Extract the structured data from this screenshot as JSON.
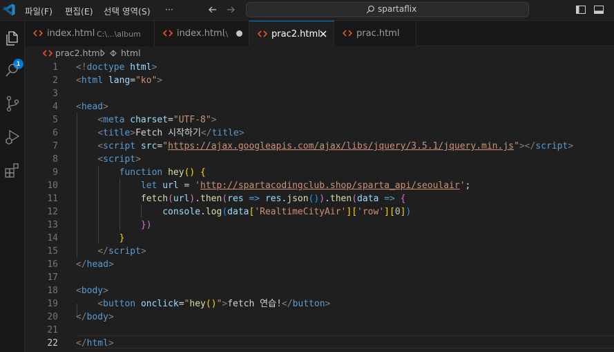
{
  "menu": {
    "file": "파일(F)",
    "edit": "편집(E)",
    "selection": "선택 영역(S)",
    "more": "···"
  },
  "command_center": {
    "text": "spartaflix"
  },
  "activity": {
    "explorer_badge": "1"
  },
  "tabs": [
    {
      "name": "index.html",
      "desc": "C:\\...\\album",
      "active": false,
      "dirty": false
    },
    {
      "name": "index.html",
      "desc": ".\\",
      "active": false,
      "dirty": true
    },
    {
      "name": "prac2.html",
      "desc": "",
      "active": true,
      "dirty": false
    },
    {
      "name": "prac.html",
      "desc": "",
      "active": false,
      "dirty": false
    }
  ],
  "breadcrumb": {
    "file": "prac2.html",
    "element": "html"
  },
  "editor": {
    "current_line": 22,
    "line_numbers": [
      "1",
      "2",
      "3",
      "4",
      "5",
      "6",
      "7",
      "8",
      "9",
      "10",
      "11",
      "12",
      "13",
      "14",
      "15",
      "16",
      "17",
      "18",
      "19",
      "20",
      "21",
      "22"
    ],
    "lines": [
      [
        [
          "t-br",
          "<!"
        ],
        [
          "t-tag",
          "doctype"
        ],
        [
          "t-txt",
          " "
        ],
        [
          "t-attr",
          "html"
        ],
        [
          "t-br",
          ">"
        ]
      ],
      [
        [
          "t-br",
          "<"
        ],
        [
          "t-tag",
          "html"
        ],
        [
          "t-txt",
          " "
        ],
        [
          "t-attr",
          "lang"
        ],
        [
          "t-txt",
          "="
        ],
        [
          "t-str",
          "\"ko\""
        ],
        [
          "t-br",
          ">"
        ]
      ],
      [],
      [
        [
          "t-br",
          "<"
        ],
        [
          "t-tag",
          "head"
        ],
        [
          "t-br",
          ">"
        ]
      ],
      [
        [
          "t-txt",
          "    "
        ],
        [
          "t-br",
          "<"
        ],
        [
          "t-tag",
          "meta"
        ],
        [
          "t-txt",
          " "
        ],
        [
          "t-attr",
          "charset"
        ],
        [
          "t-txt",
          "="
        ],
        [
          "t-str",
          "\"UTF-8\""
        ],
        [
          "t-br",
          ">"
        ]
      ],
      [
        [
          "t-txt",
          "    "
        ],
        [
          "t-br",
          "<"
        ],
        [
          "t-tag",
          "title"
        ],
        [
          "t-br",
          ">"
        ],
        [
          "t-txt",
          "Fetch 시작하기"
        ],
        [
          "t-br",
          "</"
        ],
        [
          "t-tag",
          "title"
        ],
        [
          "t-br",
          ">"
        ]
      ],
      [
        [
          "t-txt",
          "    "
        ],
        [
          "t-br",
          "<"
        ],
        [
          "t-tag",
          "script"
        ],
        [
          "t-txt",
          " "
        ],
        [
          "t-attr",
          "src"
        ],
        [
          "t-txt",
          "="
        ],
        [
          "t-str",
          "\""
        ],
        [
          "t-str u",
          "https://ajax.googleapis.com/ajax/libs/jquery/3.5.1/jquery.min.js"
        ],
        [
          "t-str",
          "\""
        ],
        [
          "t-br",
          "></"
        ],
        [
          "t-tag",
          "script"
        ],
        [
          "t-br",
          ">"
        ]
      ],
      [
        [
          "t-txt",
          "    "
        ],
        [
          "t-br",
          "<"
        ],
        [
          "t-tag",
          "script"
        ],
        [
          "t-br",
          ">"
        ]
      ],
      [
        [
          "t-txt",
          "        "
        ],
        [
          "t-kw",
          "function"
        ],
        [
          "t-txt",
          " "
        ],
        [
          "t-fn",
          "hey"
        ],
        [
          "t-b1",
          "()"
        ],
        [
          "t-txt",
          " "
        ],
        [
          "t-b1",
          "{"
        ]
      ],
      [
        [
          "t-txt",
          "            "
        ],
        [
          "t-kw",
          "let"
        ],
        [
          "t-txt",
          " "
        ],
        [
          "t-var",
          "url"
        ],
        [
          "t-txt",
          " = "
        ],
        [
          "t-str",
          "'"
        ],
        [
          "t-str u",
          "http://spartacodingclub.shop/sparta_api/seoulair"
        ],
        [
          "t-str",
          "'"
        ],
        [
          "t-txt",
          ";"
        ]
      ],
      [
        [
          "t-txt",
          "            "
        ],
        [
          "t-fn",
          "fetch"
        ],
        [
          "t-b2",
          "("
        ],
        [
          "t-var",
          "url"
        ],
        [
          "t-b2",
          ")"
        ],
        [
          "t-txt",
          "."
        ],
        [
          "t-fn",
          "then"
        ],
        [
          "t-b2",
          "("
        ],
        [
          "t-var",
          "res"
        ],
        [
          "t-txt",
          " "
        ],
        [
          "t-kw",
          "=>"
        ],
        [
          "t-txt",
          " "
        ],
        [
          "t-var",
          "res"
        ],
        [
          "t-txt",
          "."
        ],
        [
          "t-fn",
          "json"
        ],
        [
          "t-b3",
          "()"
        ],
        [
          "t-b2",
          ")"
        ],
        [
          "t-txt",
          "."
        ],
        [
          "t-fn",
          "then"
        ],
        [
          "t-b2",
          "("
        ],
        [
          "t-var",
          "data"
        ],
        [
          "t-txt",
          " "
        ],
        [
          "t-kw",
          "=>"
        ],
        [
          "t-txt",
          " "
        ],
        [
          "t-b2",
          "{"
        ]
      ],
      [
        [
          "t-txt",
          "                "
        ],
        [
          "t-var",
          "console"
        ],
        [
          "t-txt",
          "."
        ],
        [
          "t-fn",
          "log"
        ],
        [
          "t-b3",
          "("
        ],
        [
          "t-var",
          "data"
        ],
        [
          "t-b1",
          "["
        ],
        [
          "t-str",
          "'RealtimeCityAir'"
        ],
        [
          "t-b1",
          "]"
        ],
        [
          "t-b1",
          "["
        ],
        [
          "t-str",
          "'row'"
        ],
        [
          "t-b1",
          "]"
        ],
        [
          "t-b1",
          "["
        ],
        [
          "t-num",
          "0"
        ],
        [
          "t-b1",
          "]"
        ],
        [
          "t-b3",
          ")"
        ]
      ],
      [
        [
          "t-txt",
          "            "
        ],
        [
          "t-b2",
          "})"
        ]
      ],
      [
        [
          "t-txt",
          "        "
        ],
        [
          "t-b1",
          "}"
        ]
      ],
      [
        [
          "t-txt",
          "    "
        ],
        [
          "t-br",
          "</"
        ],
        [
          "t-tag",
          "script"
        ],
        [
          "t-br",
          ">"
        ]
      ],
      [
        [
          "t-br",
          "</"
        ],
        [
          "t-tag",
          "head"
        ],
        [
          "t-br",
          ">"
        ]
      ],
      [],
      [
        [
          "t-br",
          "<"
        ],
        [
          "t-tag",
          "body"
        ],
        [
          "t-br",
          ">"
        ]
      ],
      [
        [
          "t-txt",
          "    "
        ],
        [
          "t-br",
          "<"
        ],
        [
          "t-tag",
          "button"
        ],
        [
          "t-txt",
          " "
        ],
        [
          "t-attr",
          "onclick"
        ],
        [
          "t-txt",
          "="
        ],
        [
          "t-str",
          "\""
        ],
        [
          "t-fn",
          "hey"
        ],
        [
          "t-b1",
          "()"
        ],
        [
          "t-str",
          "\""
        ],
        [
          "t-br",
          ">"
        ],
        [
          "t-txt",
          "fetch 연습!"
        ],
        [
          "t-br",
          "</"
        ],
        [
          "t-tag",
          "button"
        ],
        [
          "t-br",
          ">"
        ]
      ],
      [
        [
          "t-br",
          "</"
        ],
        [
          "t-tag",
          "body"
        ],
        [
          "t-br",
          ">"
        ]
      ],
      [],
      [
        [
          "t-br",
          "</"
        ],
        [
          "t-tag",
          "html"
        ],
        [
          "t-br",
          ">"
        ]
      ]
    ]
  },
  "colors": {
    "accent": "#0078d4",
    "background": "#1f1f1f"
  }
}
